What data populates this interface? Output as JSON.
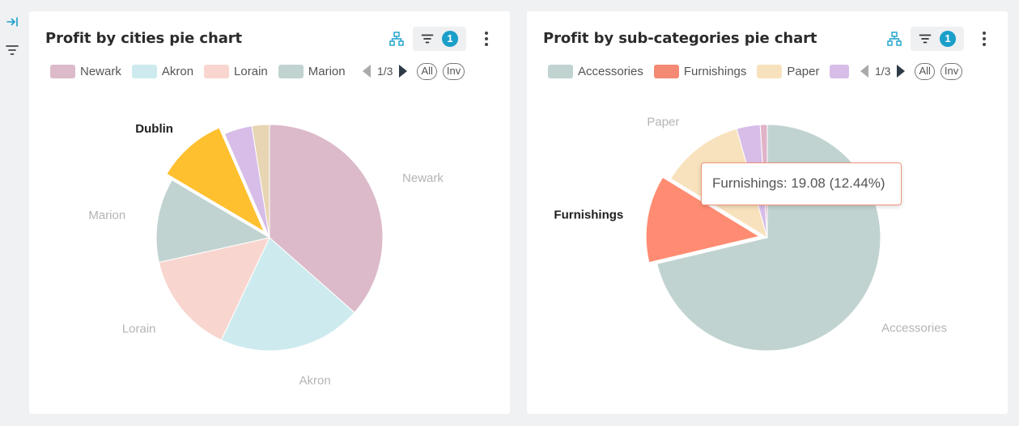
{
  "toolbar": {
    "collapse_icon": "expand-right-icon",
    "filter_icon": "filter-icon"
  },
  "cards": [
    {
      "title": "Profit by cities pie chart",
      "filter_count": "1",
      "page_text": "1/3",
      "all_label": "All",
      "inv_label": "Inv",
      "legend": [
        {
          "label": "Newark",
          "color": "#dcbac9"
        },
        {
          "label": "Akron",
          "color": "#cdebee"
        },
        {
          "label": "Lorain",
          "color": "#f8d6cf"
        },
        {
          "label": "Marion",
          "color": "#c0d3d1"
        }
      ]
    },
    {
      "title": "Profit by sub-categories pie chart",
      "filter_count": "1",
      "page_text": "1/3",
      "all_label": "All",
      "inv_label": "Inv",
      "legend": [
        {
          "label": "Accessories",
          "color": "#c0d3d1"
        },
        {
          "label": "Furnishings",
          "color": "#f48a73"
        },
        {
          "label": "Paper",
          "color": "#f8e2bd"
        },
        {
          "label": "",
          "color": "#d7bde8"
        }
      ],
      "tooltip": "Furnishings: 19.08 (12.44%)"
    }
  ],
  "chart_data": [
    {
      "type": "pie",
      "title": "Profit by cities pie chart",
      "slices": [
        {
          "label": "Newark",
          "value": 36.5,
          "color": "#dcbac9",
          "show_label": true,
          "bold": false
        },
        {
          "label": "Akron",
          "value": 20.5,
          "color": "#cdebee",
          "show_label": true,
          "bold": false
        },
        {
          "label": "Lorain",
          "value": 14.5,
          "color": "#f8d6cf",
          "show_label": true,
          "bold": false
        },
        {
          "label": "Marion",
          "value": 12.0,
          "color": "#c0d3d1",
          "show_label": true,
          "bold": false
        },
        {
          "label": "Dublin",
          "value": 10.0,
          "color": "#ffc030",
          "show_label": true,
          "bold": true,
          "exploded": true
        },
        {
          "label": "",
          "value": 4.0,
          "color": "#d7bde8",
          "show_label": false,
          "bold": false
        },
        {
          "label": "",
          "value": 2.5,
          "color": "#e7d5b3",
          "show_label": false,
          "bold": false
        }
      ],
      "legend_position": "top"
    },
    {
      "type": "pie",
      "title": "Profit by sub-categories pie chart",
      "slices": [
        {
          "label": "Accessories",
          "value": 71.3,
          "color": "#c0d3d1",
          "show_label": true,
          "bold": false
        },
        {
          "label": "Furnishings",
          "value": 12.44,
          "color": "#ff8c72",
          "show_label": true,
          "bold": true,
          "exploded": true
        },
        {
          "label": "Paper",
          "value": 11.9,
          "color": "#f8e2bd",
          "show_label": true,
          "bold": false
        },
        {
          "label": "",
          "value": 3.36,
          "color": "#d7bde8",
          "show_label": false,
          "bold": false
        },
        {
          "label": "",
          "value": 1.0,
          "color": "#e0b3c8",
          "show_label": false,
          "bold": false
        }
      ],
      "legend_position": "top"
    }
  ]
}
